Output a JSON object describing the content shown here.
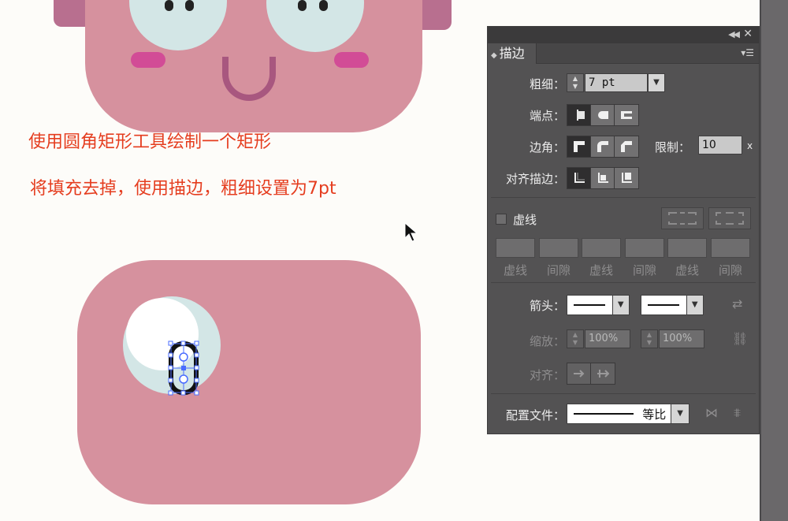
{
  "canvas": {
    "instruction_1": "使用圆角矩形工具绘制一个矩形",
    "instruction_2": "将填充去掉，使用描边，粗细设置为7pt",
    "colors": {
      "face": "#d6919e",
      "eye": "#d3e6e6",
      "cheek": "#d24c96",
      "mouth": "#a8577f",
      "instruction_text": "#e53d1f"
    }
  },
  "panel": {
    "tab_label": "描边",
    "weight": {
      "label": "粗细：",
      "value": "7 pt"
    },
    "cap": {
      "label": "端点：",
      "icons": [
        "butt-cap-icon",
        "round-cap-icon",
        "projecting-cap-icon"
      ],
      "selected": "butt-cap-icon"
    },
    "corner": {
      "label": "边角：",
      "icons": [
        "miter-join-icon",
        "round-join-icon",
        "bevel-join-icon"
      ],
      "selected": "miter-join-icon",
      "limit_label": "限制：",
      "limit_value": "10",
      "limit_suffix": "x"
    },
    "align": {
      "label": "对齐描边：",
      "icons": [
        "align-center-icon",
        "align-inside-icon",
        "align-outside-icon"
      ],
      "selected": "align-center-icon"
    },
    "dashed": {
      "label": "虚线",
      "checked": false,
      "dash_labels": [
        "虚线",
        "间隙",
        "虚线",
        "间隙",
        "虚线",
        "间隙"
      ]
    },
    "arrowheads": {
      "label": "箭头："
    },
    "scale": {
      "label": "缩放：",
      "start": "100%",
      "end": "100%"
    },
    "arrow_align": {
      "label": "对齐："
    },
    "profile": {
      "label": "配置文件：",
      "value": "等比"
    }
  }
}
